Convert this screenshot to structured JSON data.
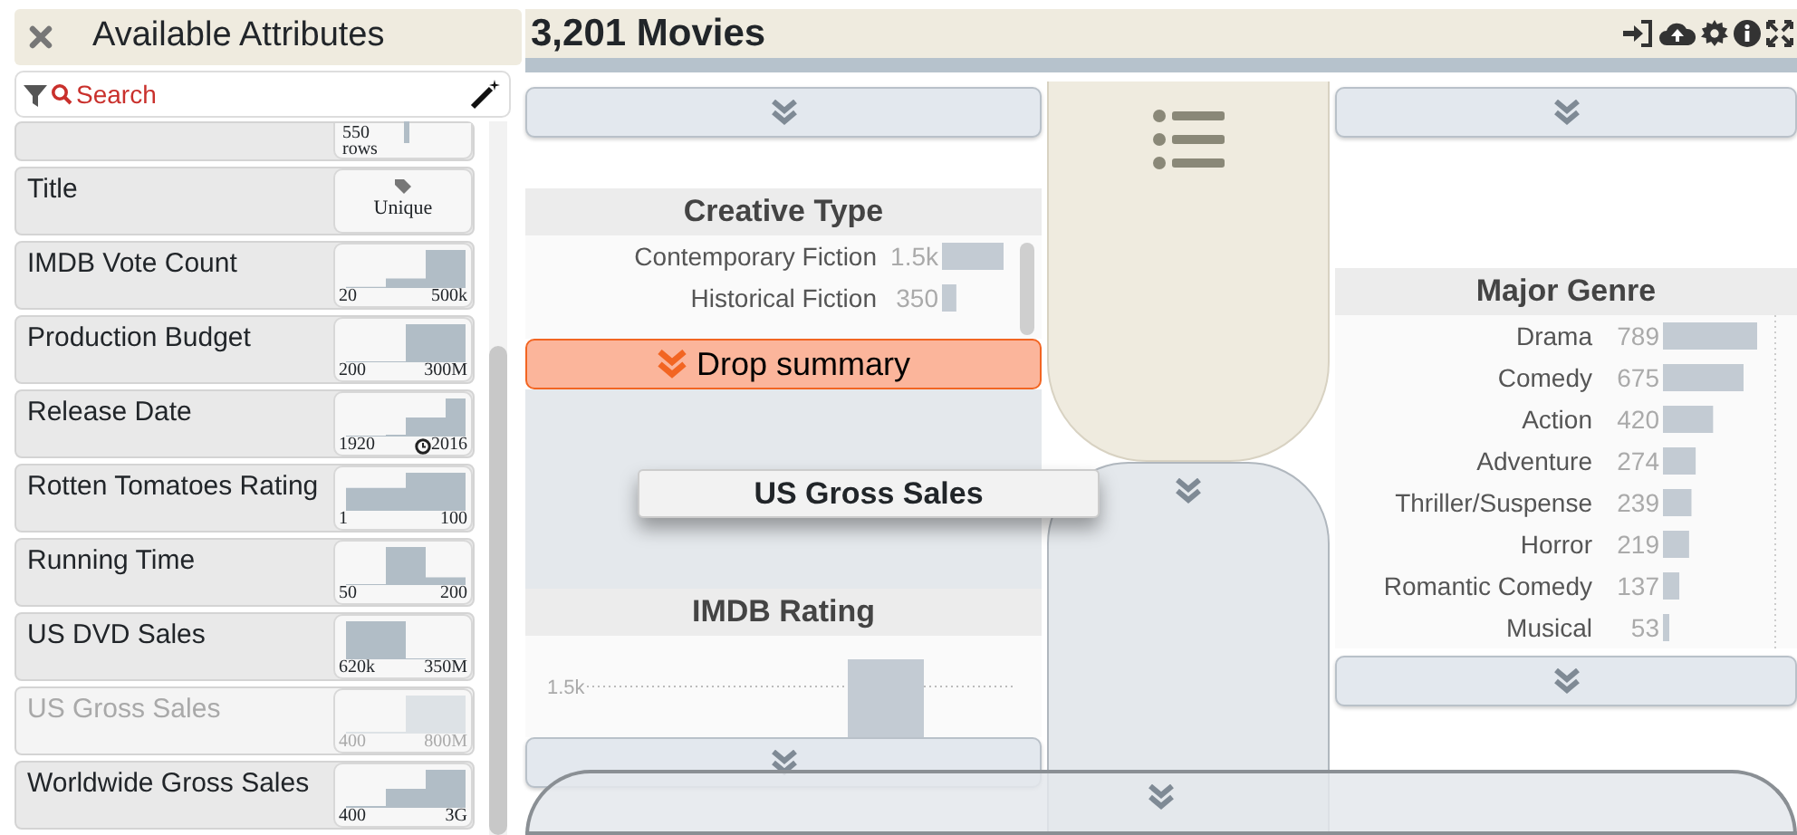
{
  "sidebar": {
    "title": "Available Attributes",
    "search": {
      "placeholder": "Search"
    },
    "attributes": [
      {
        "kind": "count",
        "summary": "550",
        "unit": "rows",
        "disabled": false
      },
      {
        "kind": "unique",
        "name": "Title",
        "summary": "Unique",
        "disabled": false
      },
      {
        "kind": "histogram",
        "name": "IMDB Vote Count",
        "min": "20",
        "max": "500k",
        "disabled": false
      },
      {
        "kind": "histogram",
        "name": "Production Budget",
        "min": "200",
        "max": "300M",
        "disabled": false
      },
      {
        "kind": "date",
        "name": "Release Date",
        "min": "1920",
        "max": "2016",
        "disabled": false
      },
      {
        "kind": "histogram",
        "name": "Rotten Tomatoes Rating",
        "min": "1",
        "max": "100",
        "disabled": false
      },
      {
        "kind": "histogram",
        "name": "Running Time",
        "min": "50",
        "max": "200",
        "disabled": false
      },
      {
        "kind": "histogram",
        "name": "US DVD Sales",
        "min": "620k",
        "max": "350M",
        "disabled": false
      },
      {
        "kind": "histogram",
        "name": "US Gross Sales",
        "min": "400",
        "max": "800M",
        "disabled": true
      },
      {
        "kind": "histogram",
        "name": "Worldwide Gross Sales",
        "min": "400",
        "max": "3G",
        "disabled": false
      }
    ]
  },
  "main": {
    "title": "3,201 Movies",
    "creative_type": {
      "title": "Creative Type",
      "chart_data": {
        "type": "bar",
        "orientation": "horizontal",
        "categories": [
          "Contemporary Fiction",
          "Historical Fiction"
        ],
        "values": [
          1500,
          350
        ],
        "value_labels": [
          "1.5k",
          "350"
        ]
      }
    },
    "drop": {
      "label": "Drop summary"
    },
    "dragged": {
      "label": "US Gross Sales"
    },
    "imdb_rating": {
      "title": "IMDB Rating",
      "tick_label": "1.5k"
    },
    "major_genre": {
      "title": "Major Genre",
      "chart_data": {
        "type": "bar",
        "orientation": "horizontal",
        "categories": [
          "Drama",
          "Comedy",
          "Action",
          "Adventure",
          "Thriller/Suspense",
          "Horror",
          "Romantic Comedy",
          "Musical"
        ],
        "values": [
          789,
          675,
          420,
          274,
          239,
          219,
          137,
          53
        ],
        "value_labels": [
          "789",
          "675",
          "420",
          "274",
          "239",
          "219",
          "137",
          "53"
        ]
      }
    }
  }
}
